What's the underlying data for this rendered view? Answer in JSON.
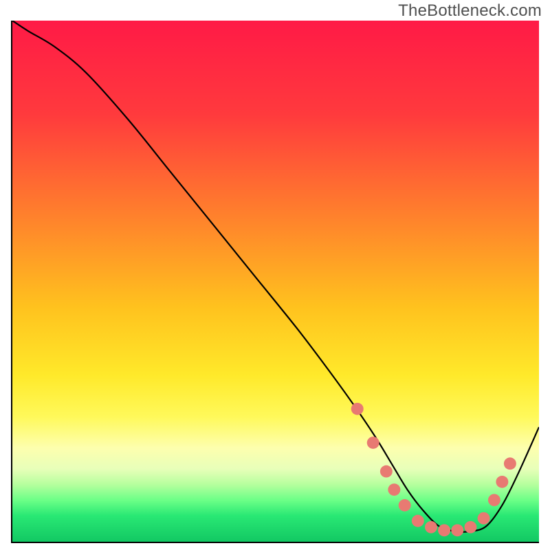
{
  "watermark": "TheBottleneck.com",
  "chart_data": {
    "type": "line",
    "title": "",
    "xlabel": "",
    "ylabel": "",
    "xlim": [
      0,
      100
    ],
    "ylim": [
      0,
      100
    ],
    "gradient_stops": [
      {
        "offset": 0,
        "color": "#ff1a46"
      },
      {
        "offset": 18,
        "color": "#ff3a3d"
      },
      {
        "offset": 40,
        "color": "#ff8a2a"
      },
      {
        "offset": 55,
        "color": "#ffc21e"
      },
      {
        "offset": 68,
        "color": "#ffe92a"
      },
      {
        "offset": 76,
        "color": "#fff95a"
      },
      {
        "offset": 82,
        "color": "#fdffae"
      },
      {
        "offset": 86,
        "color": "#e8ffb9"
      },
      {
        "offset": 89,
        "color": "#b6ff9e"
      },
      {
        "offset": 92,
        "color": "#6cff87"
      },
      {
        "offset": 95,
        "color": "#29e874"
      },
      {
        "offset": 100,
        "color": "#12c863"
      }
    ],
    "series": [
      {
        "name": "bottleneck-curve",
        "x": [
          0,
          3,
          8,
          14,
          22,
          30,
          38,
          46,
          54,
          60,
          65,
          69,
          72,
          75,
          78,
          81,
          84,
          87,
          90,
          93,
          96,
          100
        ],
        "y": [
          100,
          98,
          95,
          90,
          81,
          71,
          61,
          51,
          41,
          33,
          26,
          20,
          15,
          10,
          6,
          3,
          2,
          2,
          3,
          7,
          13,
          22
        ]
      }
    ],
    "markers": {
      "name": "highlight-dots",
      "color": "#e87a72",
      "radius": 9,
      "points": [
        {
          "x": 65.5,
          "y": 25.5
        },
        {
          "x": 68.5,
          "y": 19.0
        },
        {
          "x": 71.0,
          "y": 13.5
        },
        {
          "x": 72.5,
          "y": 10.0
        },
        {
          "x": 74.5,
          "y": 7.0
        },
        {
          "x": 77.0,
          "y": 4.0
        },
        {
          "x": 79.5,
          "y": 2.8
        },
        {
          "x": 82.0,
          "y": 2.2
        },
        {
          "x": 84.5,
          "y": 2.2
        },
        {
          "x": 87.0,
          "y": 2.8
        },
        {
          "x": 89.5,
          "y": 4.5
        },
        {
          "x": 91.5,
          "y": 8.0
        },
        {
          "x": 93.0,
          "y": 11.5
        },
        {
          "x": 94.5,
          "y": 15.0
        }
      ]
    }
  }
}
